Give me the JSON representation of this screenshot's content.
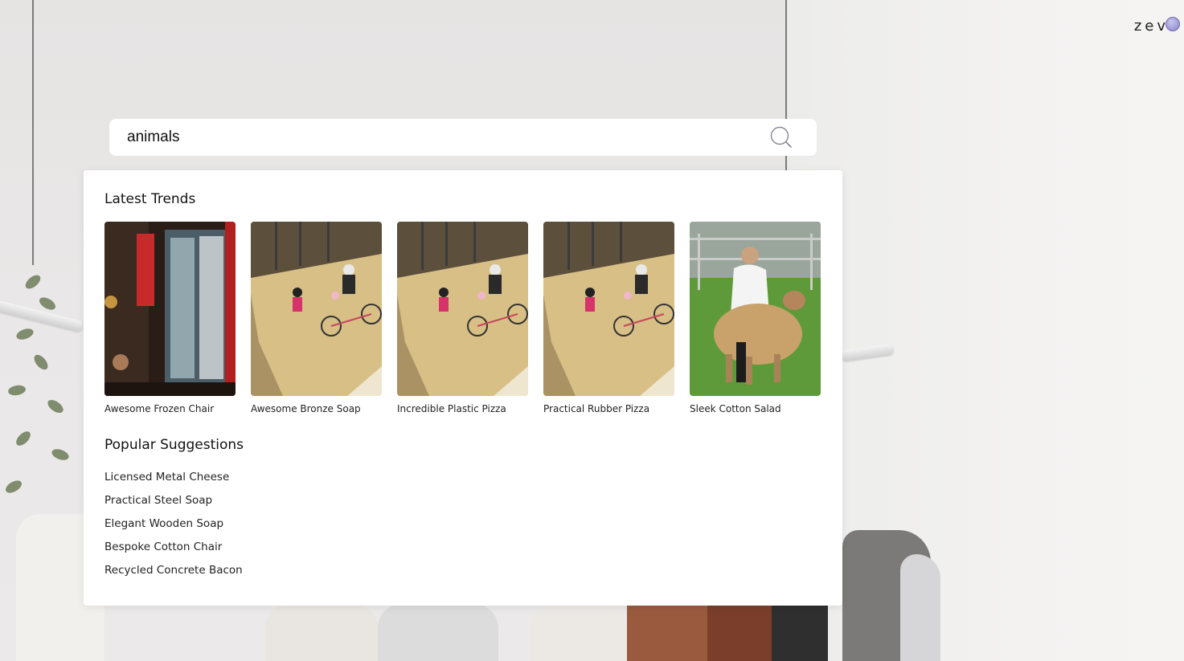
{
  "brand": {
    "logo_text": "zevi"
  },
  "search": {
    "value": "animals",
    "icon": "search-icon"
  },
  "latest_trends": {
    "title": "Latest Trends",
    "items": [
      {
        "label": "Awesome Frozen Chair",
        "image": "storefront-photo"
      },
      {
        "label": "Awesome Bronze Soap",
        "image": "cyclists-photo"
      },
      {
        "label": "Incredible Plastic Pizza",
        "image": "cyclists-photo"
      },
      {
        "label": "Practical Rubber Pizza",
        "image": "cyclists-photo"
      },
      {
        "label": "Sleek Cotton Salad",
        "image": "sheep-show-photo"
      }
    ]
  },
  "popular_suggestions": {
    "title": "Popular Suggestions",
    "items": [
      "Licensed Metal Cheese",
      "Practical Steel Soap",
      "Elegant Wooden Soap",
      "Bespoke Cotton Chair",
      "Recycled Concrete Bacon"
    ]
  },
  "colors": {
    "panel": "#ffffff",
    "text": "#111111",
    "logo_accent": "#9a96d6"
  }
}
